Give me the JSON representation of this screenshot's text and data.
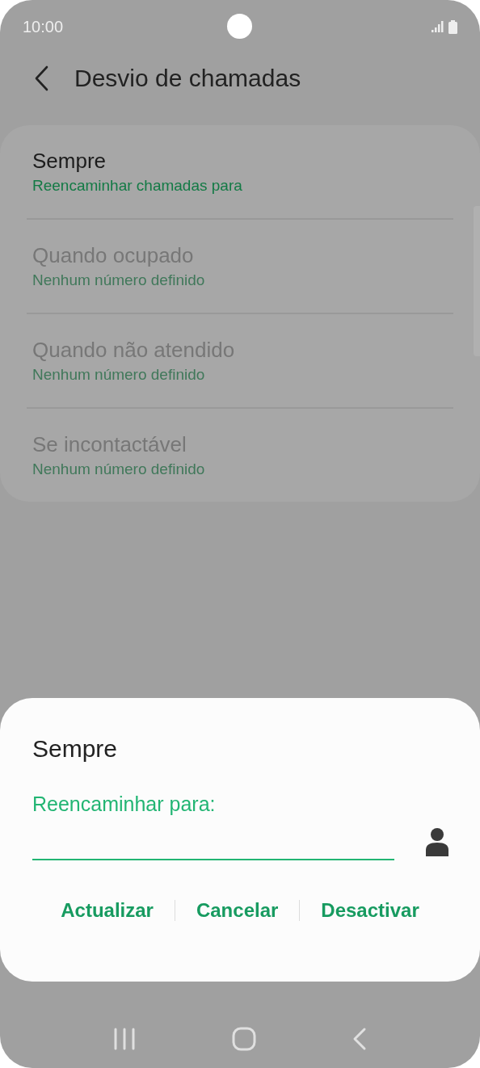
{
  "status_bar": {
    "time": "10:00"
  },
  "header": {
    "title": "Desvio de chamadas"
  },
  "options": [
    {
      "title": "Sempre",
      "subtitle": "Reencaminhar chamadas para",
      "disabled": false
    },
    {
      "title": "Quando ocupado",
      "subtitle": "Nenhum número definido",
      "disabled": true
    },
    {
      "title": "Quando não atendido",
      "subtitle": "Nenhum número definido",
      "disabled": true
    },
    {
      "title": "Se incontactável",
      "subtitle": "Nenhum número definido",
      "disabled": true
    }
  ],
  "dialog": {
    "title": "Sempre",
    "field_label": "Reencaminhar para:",
    "buttons": [
      "Actualizar",
      "Cancelar",
      "Desactivar"
    ]
  }
}
